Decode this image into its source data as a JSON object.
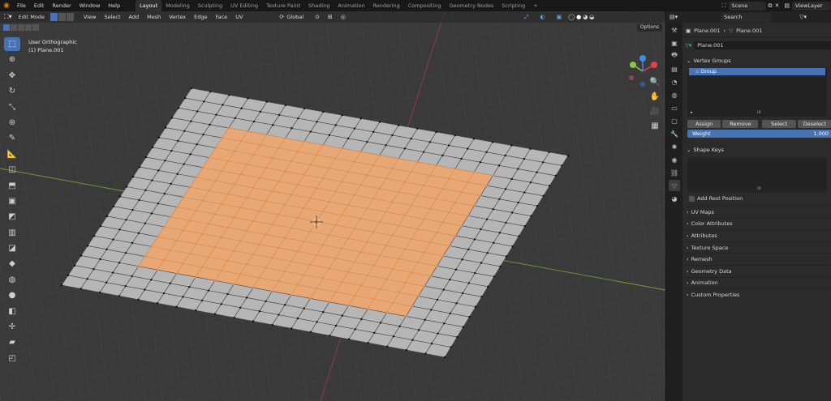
{
  "menu": [
    "File",
    "Edit",
    "Render",
    "Window",
    "Help"
  ],
  "workspaces": [
    {
      "label": "Layout",
      "active": true
    },
    {
      "label": "Modeling"
    },
    {
      "label": "Sculpting"
    },
    {
      "label": "UV Editing"
    },
    {
      "label": "Texture Paint"
    },
    {
      "label": "Shading"
    },
    {
      "label": "Animation"
    },
    {
      "label": "Rendering"
    },
    {
      "label": "Compositing"
    },
    {
      "label": "Geometry Nodes"
    },
    {
      "label": "Scripting"
    }
  ],
  "add_workspace": "+",
  "scene_name": "Scene",
  "view_layer": "ViewLayer",
  "viewport": {
    "mode": "Edit Mode",
    "menus": [
      "View",
      "Select",
      "Add",
      "Mesh",
      "Vertex",
      "Edge",
      "Face",
      "UV"
    ],
    "transform_orientation": "Global",
    "options": "Options",
    "view_name": "User Orthographic",
    "object_name": "(1) Plane.001",
    "gizmo_axes": {
      "x": "#e0414f",
      "y": "#8bc34a",
      "z": "#3d8ee8"
    }
  },
  "properties": {
    "search_placeholder": "Search",
    "breadcrumb_object": "Plane.001",
    "breadcrumb_mesh": "Plane.001",
    "mesh_datablock": "Plane.001",
    "vertex_groups": {
      "title": "Vertex Groups",
      "items": [
        "Group"
      ],
      "assign": "Assign",
      "remove": "Remove",
      "select": "Select",
      "deselect": "Deselect",
      "weight_label": "Weight",
      "weight_value": "1.000"
    },
    "shape_keys": {
      "title": "Shape Keys",
      "add_rest_position": "Add Rest Position"
    },
    "collapsed_panels": [
      "UV Maps",
      "Color Attributes",
      "Attributes",
      "Texture Space",
      "Remesh",
      "Geometry Data",
      "Animation",
      "Custom Properties"
    ]
  },
  "colors": {
    "selection": "#f08a2a",
    "accent": "#4772b3"
  }
}
